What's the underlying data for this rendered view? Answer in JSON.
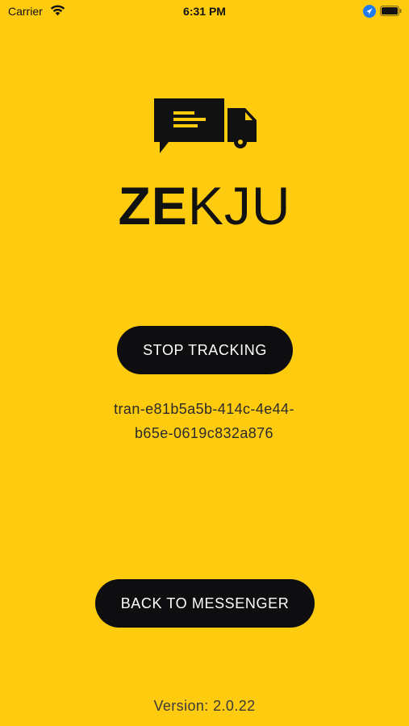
{
  "status_bar": {
    "carrier": "Carrier",
    "time": "6:31 PM",
    "icons": [
      "wifi-icon",
      "location-icon",
      "battery-icon"
    ]
  },
  "logo": {
    "icon": "chat-truck-icon",
    "wordmark_bold": "ZE",
    "wordmark_light": "KJU"
  },
  "tracking": {
    "stop_label": "STOP TRACKING",
    "id_text": "tran-e81b5a5b-414c-4e44-\nb65e-0619c832a876"
  },
  "messenger": {
    "back_label": "BACK TO MESSENGER"
  },
  "footer": {
    "version": "Version: 2.0.22"
  },
  "colors": {
    "background": "#FECB0E",
    "button": "#0E0E10",
    "button_text": "#FFFFFF",
    "text": "#111111"
  }
}
